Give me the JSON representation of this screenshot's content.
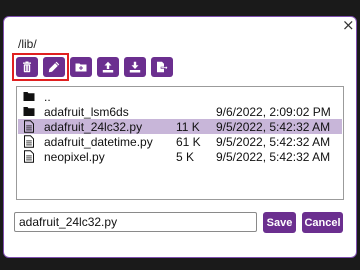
{
  "dialog": {
    "path": "/lib/",
    "close_glyph": "×"
  },
  "toolbar": {
    "buttons": [
      {
        "icon": "trash-icon"
      },
      {
        "icon": "pencil-icon"
      },
      {
        "icon": "new-folder-icon"
      },
      {
        "icon": "upload-icon"
      },
      {
        "icon": "download-icon"
      },
      {
        "icon": "move-file-icon"
      }
    ]
  },
  "files": [
    {
      "type": "folder",
      "name": "..",
      "size": "",
      "modified": ""
    },
    {
      "type": "folder",
      "name": "adafruit_lsm6ds",
      "size": "",
      "modified": "9/6/2022, 2:09:02 PM"
    },
    {
      "type": "file",
      "name": "adafruit_24lc32.py",
      "size": "11 K",
      "modified": "9/5/2022, 5:42:32 AM",
      "selected": true
    },
    {
      "type": "file",
      "name": "adafruit_datetime.py",
      "size": "61 K",
      "modified": "9/5/2022, 5:42:32 AM"
    },
    {
      "type": "file",
      "name": "neopixel.py",
      "size": "5 K",
      "modified": "9/5/2022, 5:42:32 AM"
    }
  ],
  "footer": {
    "filename_value": "adafruit_24lc32.py",
    "save_label": "Save",
    "cancel_label": "Cancel"
  },
  "colors": {
    "accent": "#6b2f8f",
    "selection": "#c8b6d9",
    "highlight": "#e02020"
  }
}
